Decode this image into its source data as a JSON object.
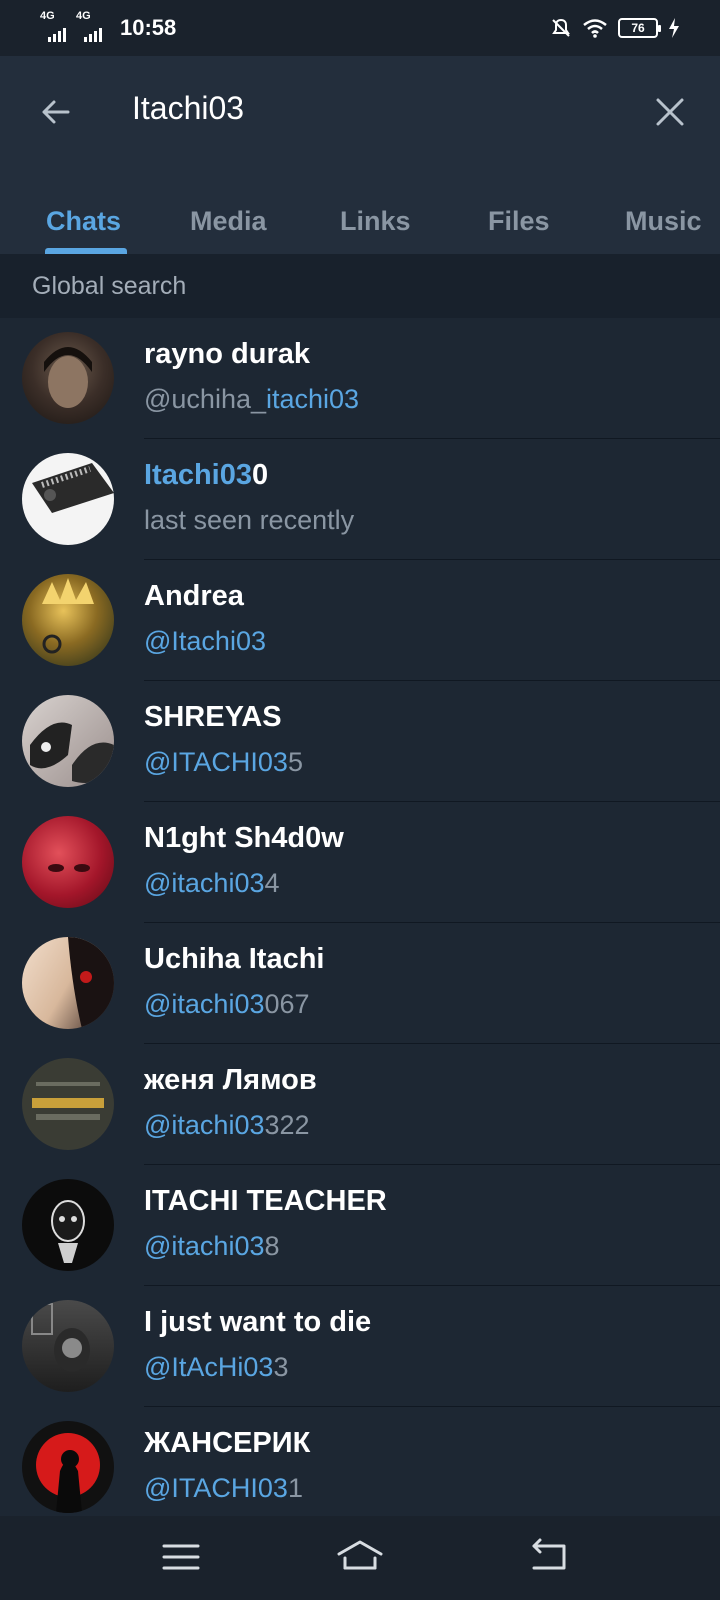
{
  "status_bar": {
    "network1": "4G",
    "network2": "4G",
    "time": "10:58",
    "battery": "76",
    "icons": [
      "mute-icon",
      "wifi-icon",
      "battery-icon",
      "charging-icon"
    ]
  },
  "header": {
    "search_query": "Itachi03",
    "back_icon": "arrow-left-icon",
    "clear_icon": "close-icon"
  },
  "tabs": [
    {
      "label": "Chats",
      "active": true
    },
    {
      "label": "Media",
      "active": false
    },
    {
      "label": "Links",
      "active": false
    },
    {
      "label": "Files",
      "active": false
    },
    {
      "label": "Music",
      "active": false
    }
  ],
  "section": {
    "title": "Global search"
  },
  "results": [
    {
      "name_hl": "",
      "name_rest": "rayno durak",
      "sub_plain_pre": "@uchiha_",
      "sub_hl": "itachi03",
      "sub_rest": ""
    },
    {
      "name_hl": "Itachi03",
      "name_rest": "0",
      "sub_plain_pre": "last seen recently",
      "sub_hl": "",
      "sub_rest": ""
    },
    {
      "name_hl": "",
      "name_rest": "Andrea",
      "sub_plain_pre": "",
      "sub_hl": "@Itachi03",
      "sub_rest": ""
    },
    {
      "name_hl": "",
      "name_rest": "SHREYAS",
      "sub_plain_pre": "",
      "sub_hl": "@ITACHI03",
      "sub_rest": "5"
    },
    {
      "name_hl": "",
      "name_rest": "N1ght Sh4d0w",
      "sub_plain_pre": "",
      "sub_hl": "@itachi03",
      "sub_rest": "4"
    },
    {
      "name_hl": "",
      "name_rest": "Uchiha Itachi",
      "sub_plain_pre": "",
      "sub_hl": "@itachi03",
      "sub_rest": "067"
    },
    {
      "name_hl": "",
      "name_rest": "женя Лямов",
      "sub_plain_pre": "",
      "sub_hl": "@itachi03",
      "sub_rest": "322"
    },
    {
      "name_hl": "",
      "name_rest": "ITACHI TEACHER",
      "sub_plain_pre": "",
      "sub_hl": "@itachi03",
      "sub_rest": "8"
    },
    {
      "name_hl": "",
      "name_rest": "I just want to die",
      "sub_plain_pre": "",
      "sub_hl": "@ItAcHi03",
      "sub_rest": "3"
    },
    {
      "name_hl": "",
      "name_rest": "ЖАНСЕРИК",
      "sub_plain_pre": "",
      "sub_hl": "@ITACHI03",
      "sub_rest": "1"
    }
  ],
  "colors": {
    "accent": "#5aa6e2",
    "background": "#1d2733",
    "header": "#232e3c",
    "muted_text": "#8a96a3"
  },
  "navbar": {
    "icons": [
      "menu-icon",
      "home-icon",
      "back-icon"
    ]
  }
}
